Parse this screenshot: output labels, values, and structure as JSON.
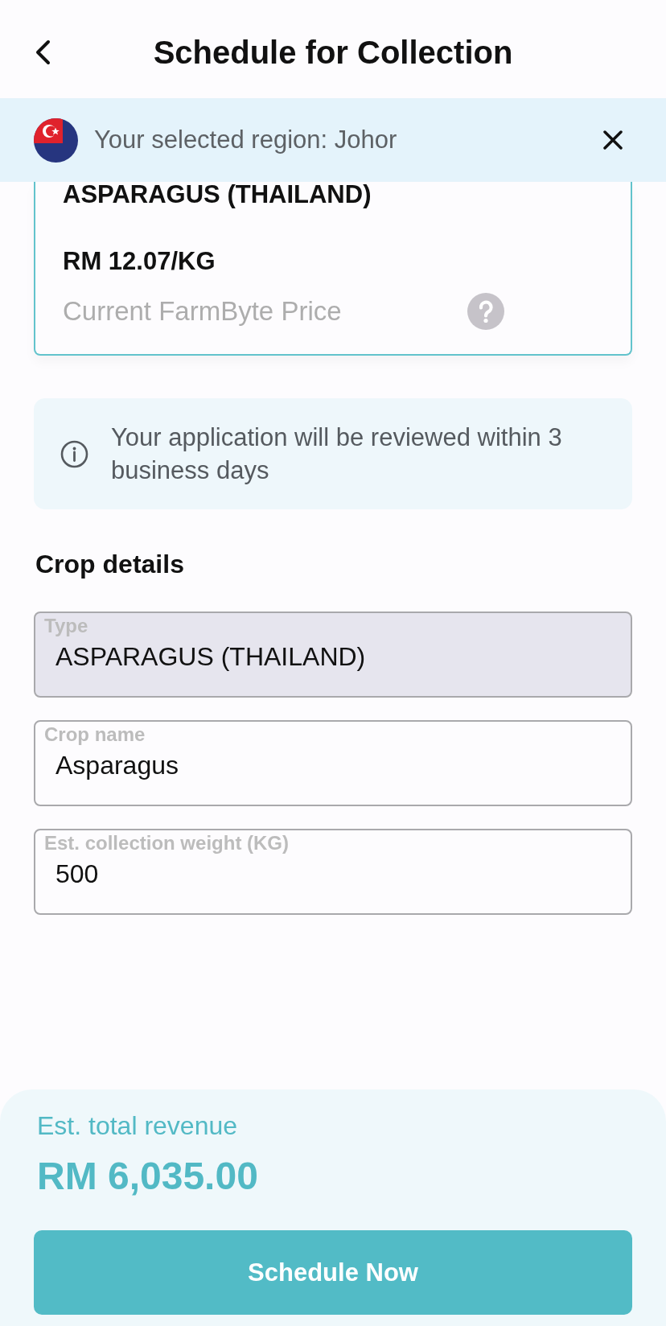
{
  "header": {
    "title": "Schedule for Collection"
  },
  "region_banner": {
    "text": "Your selected region: Johor"
  },
  "price_card": {
    "crop": "ASPARAGUS (THAILAND)",
    "price": "RM 12.07/KG",
    "caption": "Current FarmByte Price"
  },
  "notice": {
    "text": "Your application will be reviewed within 3 business days"
  },
  "crop_details": {
    "heading": "Crop details",
    "fields": [
      {
        "label": "Type",
        "value": "ASPARAGUS (THAILAND)",
        "disabled": true
      },
      {
        "label": "Crop name",
        "value": "Asparagus",
        "disabled": false
      },
      {
        "label": "Est. collection weight (KG)",
        "value": "500",
        "disabled": false
      }
    ]
  },
  "footer": {
    "label": "Est. total revenue",
    "amount": "RM 6,035.00",
    "button": "Schedule Now"
  }
}
